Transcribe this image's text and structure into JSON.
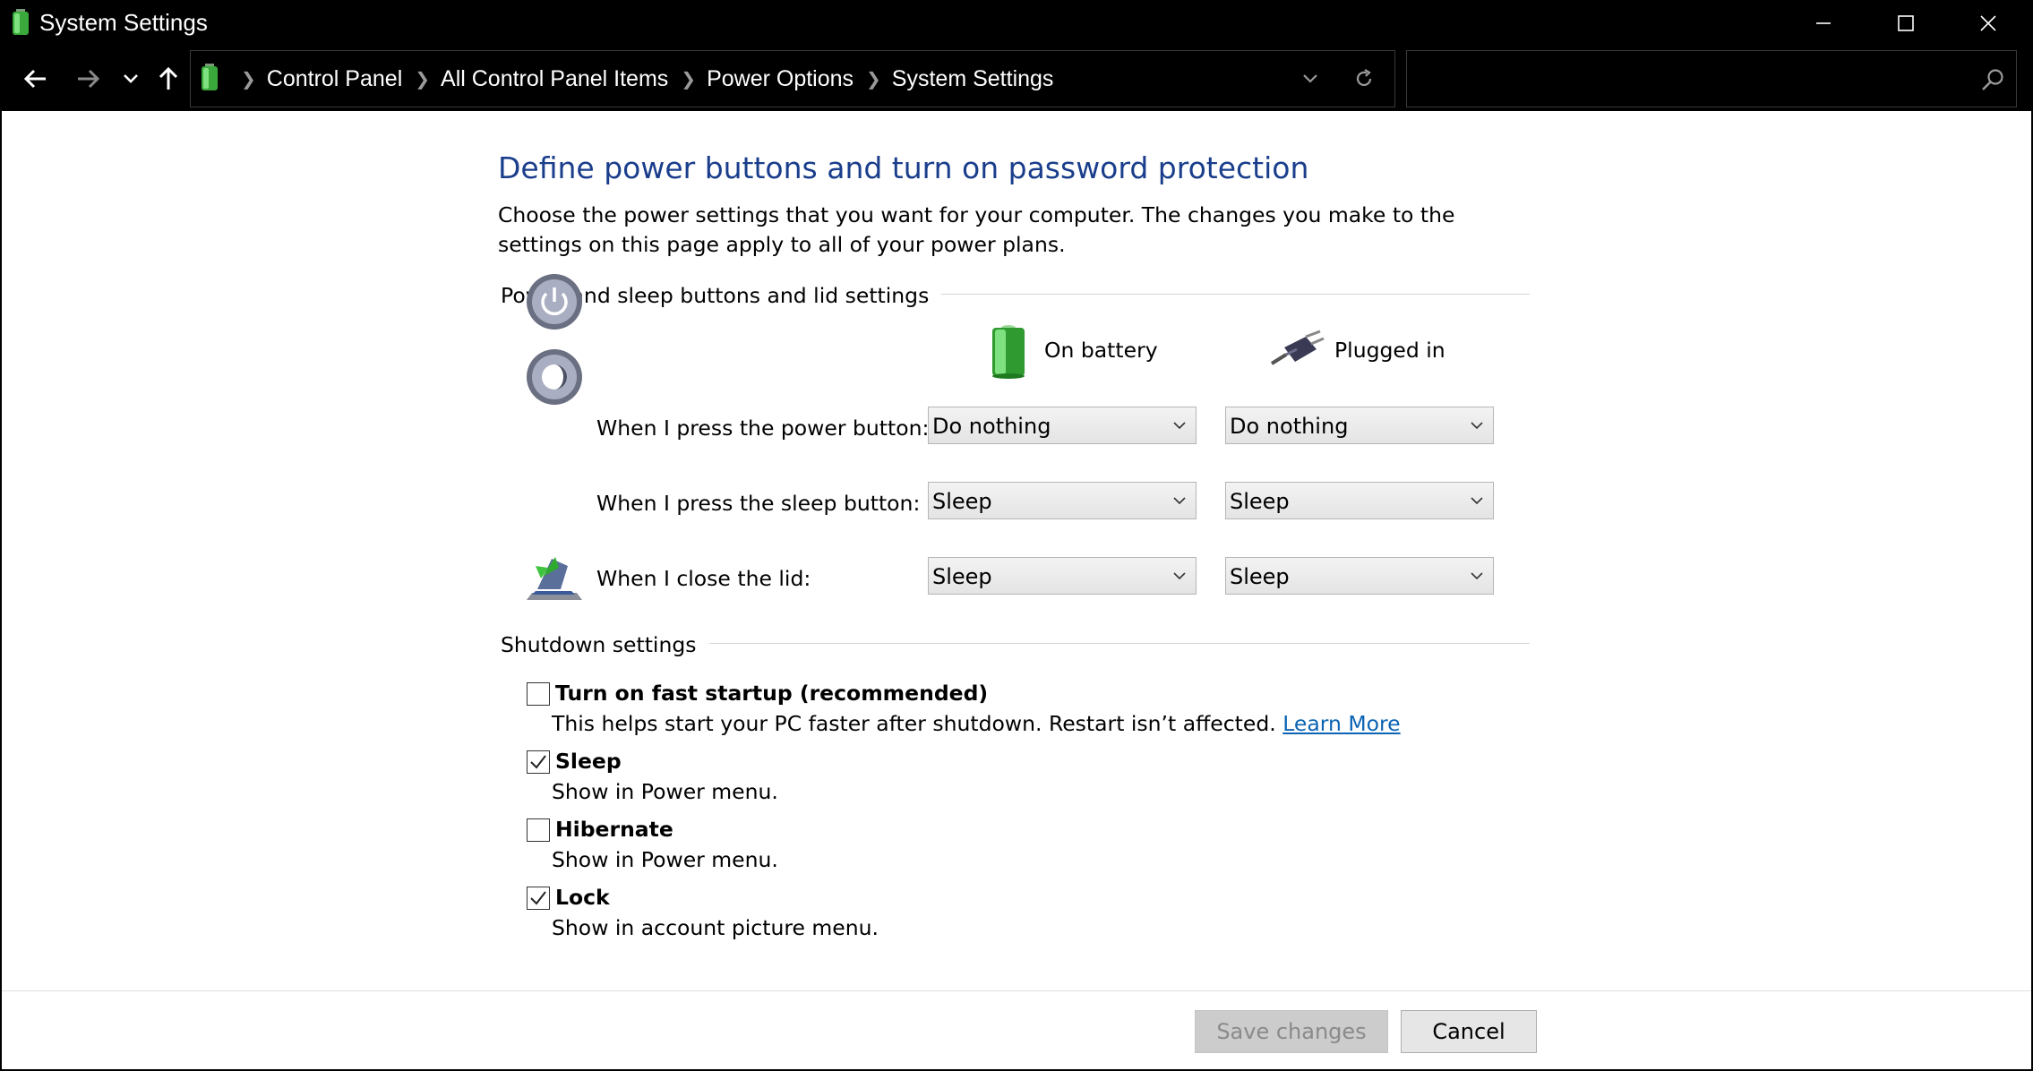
{
  "window": {
    "title": "System Settings",
    "controls": {
      "minimize_icon": "minimize-icon",
      "maximize_icon": "maximize-icon",
      "close_icon": "close-icon"
    }
  },
  "nav": {
    "back_icon": "arrow-left-icon",
    "forward_icon": "arrow-right-icon",
    "recent_icon": "chevron-down-icon",
    "up_icon": "arrow-up-icon",
    "breadcrumbs": [
      "Control Panel",
      "All Control Panel Items",
      "Power Options",
      "System Settings"
    ],
    "refresh_icon": "refresh-icon",
    "search": {
      "value": "",
      "placeholder": "",
      "icon": "search-icon"
    }
  },
  "page": {
    "title": "Define power buttons and turn on password protection",
    "description": "Choose the power settings that you want for your computer. The changes you make to the settings on this page apply to all of your power plans."
  },
  "buttons_section": {
    "title": "Power and sleep buttons and lid settings",
    "columns": [
      "On battery",
      "Plugged in"
    ],
    "rows": [
      {
        "label": "When I press the power button:",
        "icon": "power-button-icon",
        "on_battery": "Do nothing",
        "plugged_in": "Do nothing"
      },
      {
        "label": "When I press the sleep button:",
        "icon": "sleep-button-icon",
        "on_battery": "Sleep",
        "plugged_in": "Sleep"
      },
      {
        "label": "When I close the lid:",
        "icon": "laptop-lid-icon",
        "on_battery": "Sleep",
        "plugged_in": "Sleep"
      }
    ]
  },
  "shutdown_section": {
    "title": "Shutdown settings",
    "options": [
      {
        "label": "Turn on fast startup (recommended)",
        "checked": false,
        "description": "This helps start your PC faster after shutdown. Restart isn’t affected.",
        "link": "Learn More"
      },
      {
        "label": "Sleep",
        "checked": true,
        "description": "Show in Power menu."
      },
      {
        "label": "Hibernate",
        "checked": false,
        "description": "Show in Power menu."
      },
      {
        "label": "Lock",
        "checked": true,
        "description": "Show in account picture menu."
      }
    ]
  },
  "footer": {
    "save_label": "Save changes",
    "save_enabled": false,
    "cancel_label": "Cancel"
  },
  "colors": {
    "title_blue": "#1a3e8c",
    "link_blue": "#0b63b3",
    "chrome_bg": "#000000",
    "content_bg": "#ffffff"
  }
}
